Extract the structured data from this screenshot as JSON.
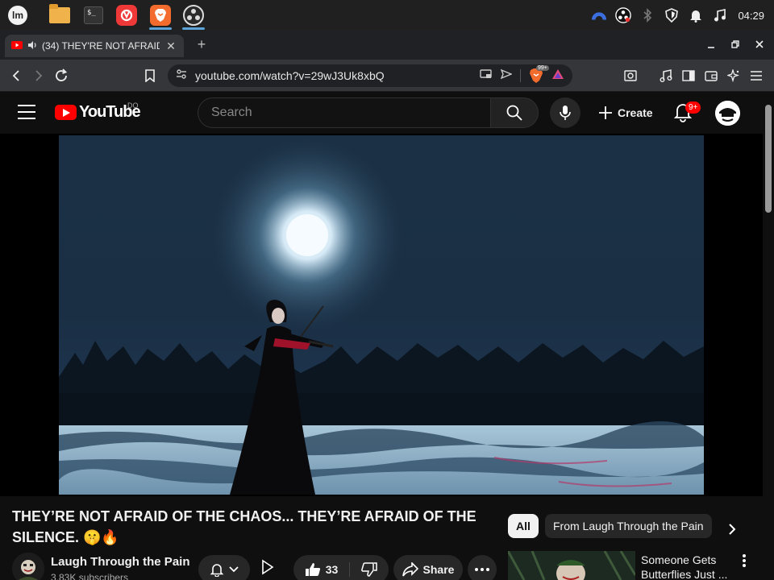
{
  "os": {
    "clock": "04:29",
    "apps": [
      "mint-menu",
      "files",
      "terminal",
      "vivaldi",
      "brave",
      "obs"
    ]
  },
  "browser": {
    "tab_title": "(34) THEY'RE NOT AFRAID",
    "tab_audio_icon": "speaker-icon",
    "url": "youtube.com/watch?v=29wJ3Uk8xbQ",
    "brave_shield_count": "99+"
  },
  "youtube": {
    "logo_text": "YouTube",
    "country_code": "DO",
    "search_placeholder": "Search",
    "create_label": "Create",
    "notifications_badge": "9+",
    "video": {
      "title": "THEY’RE NOT AFRAID OF THE CHAOS... THEY’RE AFRAID OF THE SILENCE. 🤫🔥"
    },
    "channel": {
      "name": "Laugh Through the Pain",
      "subscribers": "3.83K subscribers"
    },
    "actions": {
      "like_count": "33",
      "share_label": "Share"
    },
    "chips": {
      "all": "All",
      "from_channel": "From Laugh Through the Pain"
    },
    "recommendation": {
      "title": "Someone Gets Butterflies Just ..."
    }
  },
  "colors": {
    "yt_red": "#ff0000",
    "background": "#0f0f0f",
    "chip_active": "#f1f1f1"
  }
}
